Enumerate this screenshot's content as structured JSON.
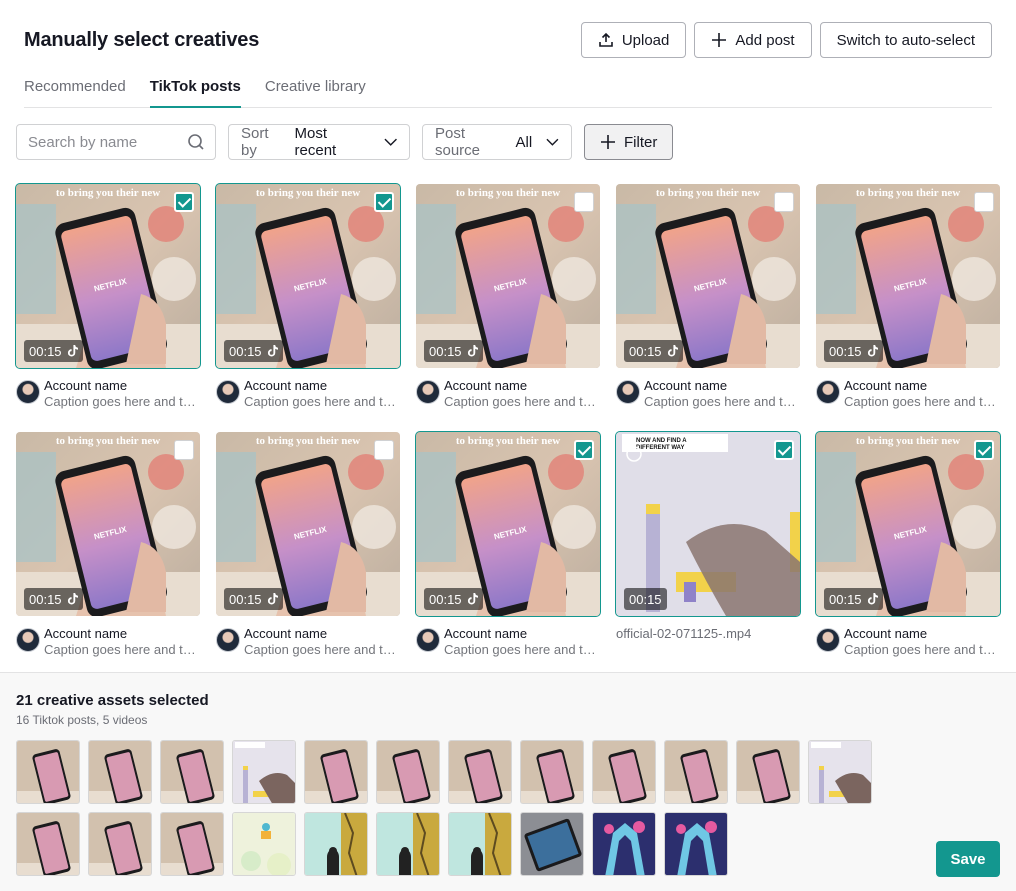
{
  "header": {
    "title": "Manually select creatives",
    "upload_label": "Upload",
    "add_post_label": "Add post",
    "auto_select_label": "Switch to auto-select"
  },
  "tabs": [
    {
      "label": "Recommended",
      "active": false
    },
    {
      "label": "TikTok posts",
      "active": true
    },
    {
      "label": "Creative library",
      "active": false
    }
  ],
  "toolbar": {
    "search_placeholder": "Search by name",
    "sort_label": "Sort by",
    "sort_value": "Most recent",
    "source_label": "Post source",
    "source_value": "All",
    "filter_label": "Filter"
  },
  "posts": [
    {
      "duration": "00:15",
      "account": "Account name",
      "caption": "Caption goes here and truncates",
      "checked": true,
      "kind": "phone"
    },
    {
      "duration": "00:15",
      "account": "Account name",
      "caption": "Caption goes here and truncates",
      "checked": true,
      "kind": "phone"
    },
    {
      "duration": "00:15",
      "account": "Account name",
      "caption": "Caption goes here and truncates",
      "checked": false,
      "kind": "phone"
    },
    {
      "duration": "00:15",
      "account": "Account name",
      "caption": "Caption goes here and truncates",
      "checked": false,
      "kind": "phone"
    },
    {
      "duration": "00:15",
      "account": "Account name",
      "caption": "Caption goes here and truncates",
      "checked": false,
      "kind": "phone"
    },
    {
      "duration": "00:15",
      "account": "Account name",
      "caption": "Caption goes here and truncates",
      "checked": false,
      "kind": "phone"
    },
    {
      "duration": "00:15",
      "account": "Account name",
      "caption": "Caption goes here and truncates",
      "checked": false,
      "kind": "phone"
    },
    {
      "duration": "00:15",
      "account": "Account name",
      "caption": "Caption goes here and truncates",
      "checked": true,
      "kind": "phone"
    },
    {
      "duration": "00:15",
      "filename": "official-02-071125-.mp4",
      "checked": true,
      "kind": "game"
    },
    {
      "duration": "00:15",
      "account": "Account name",
      "caption": "Caption goes here and truncates",
      "checked": true,
      "kind": "phone"
    }
  ],
  "overlay_text": "to bring you their new",
  "game_overlay_text": [
    "NOW AND FIND A",
    "DIFFERENT WAY"
  ],
  "selection": {
    "count_label": "21 creative assets selected",
    "sub_label": "16 Tiktok posts, 5 videos"
  },
  "selected_thumbs": [
    "phone",
    "phone",
    "phone",
    "game",
    "phone",
    "phone",
    "phone",
    "phone",
    "phone",
    "phone",
    "phone",
    "game",
    "phone",
    "phone",
    "phone",
    "birds",
    "teal",
    "teal",
    "teal",
    "tablet",
    "purple",
    "purple"
  ],
  "save_label": "Save",
  "colors": {
    "accent": "#13978f"
  }
}
